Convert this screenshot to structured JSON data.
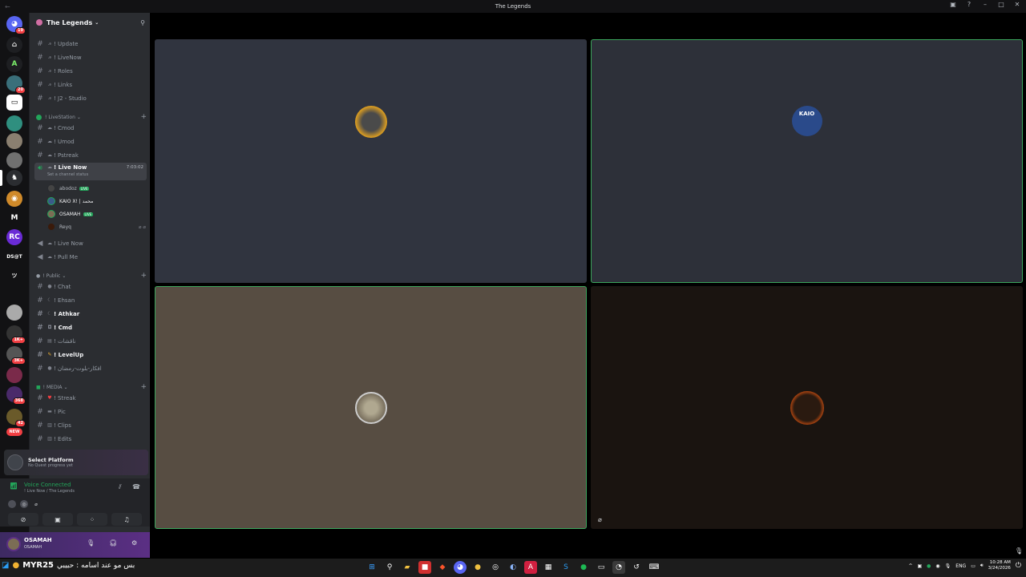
{
  "window": {
    "title": "The Legends"
  },
  "server": {
    "name": "The Legends"
  },
  "rail_badges": [
    "19",
    "20",
    "1K+",
    "3K+",
    "368",
    "42",
    "NEW"
  ],
  "rail_labels": {
    "ds": "DS@T"
  },
  "channels_top": [
    "! Update",
    "! LiveNow",
    "! Roles",
    "! Links",
    "! J2 - Studio"
  ],
  "cat_livestation": "! LiveStation",
  "livestation_channels": [
    "! Cmod",
    "! Umod",
    "! Pstreak"
  ],
  "live_now": {
    "name": "! Live Now",
    "timer": "7:03:02",
    "status": "Set a channel status"
  },
  "voice_users": [
    {
      "name": "abodoz",
      "live": "LIVE"
    },
    {
      "name": "KAIO X! | محمد",
      "live": ""
    },
    {
      "name": "OSAMAH",
      "live": "LIVE"
    },
    {
      "name": "Reyq",
      "live": ""
    }
  ],
  "voice_more": [
    "! Live Now",
    "! Pull Me"
  ],
  "cat_public": "! Public",
  "public_channels": [
    "! Chat",
    "! Ehsan",
    "! Athkar",
    "! Cmd",
    "! ناقشات",
    "! LevelUp",
    "! افكار-بلوت-رمضان"
  ],
  "cat_media": "! MEDIA",
  "media_channels": [
    "! Streak",
    "! Pic",
    "! Clips",
    "! Edits"
  ],
  "quest": {
    "title": "Select Platform",
    "sub": "No Quest progress yet"
  },
  "voice_panel": {
    "title": "Voice Connected",
    "sub": "! Live Now / The Legends"
  },
  "user": {
    "name": "OSAMAH",
    "status": "OSAMAH"
  },
  "colors": {
    "rail": "#121214",
    "sidebar": "#2b2d31",
    "accent": "#23a55a",
    "tile1": "#30343f",
    "tile2": "#2d3039",
    "tile3": "#574d42",
    "tile4": "#1a1410"
  },
  "tiles": [
    {
      "name": "tile-1",
      "avatar_text": ""
    },
    {
      "name": "tile-2",
      "avatar_text": "KAIO"
    },
    {
      "name": "tile-3",
      "avatar_text": ""
    },
    {
      "name": "tile-4",
      "avatar_text": ""
    }
  ],
  "taskbar": {
    "left_text": "MYR25",
    "marquee": "بس مو عند اسامه : حبيبي",
    "lang": "ENG",
    "time": "10:28 AM",
    "date": "3/24/2026"
  }
}
